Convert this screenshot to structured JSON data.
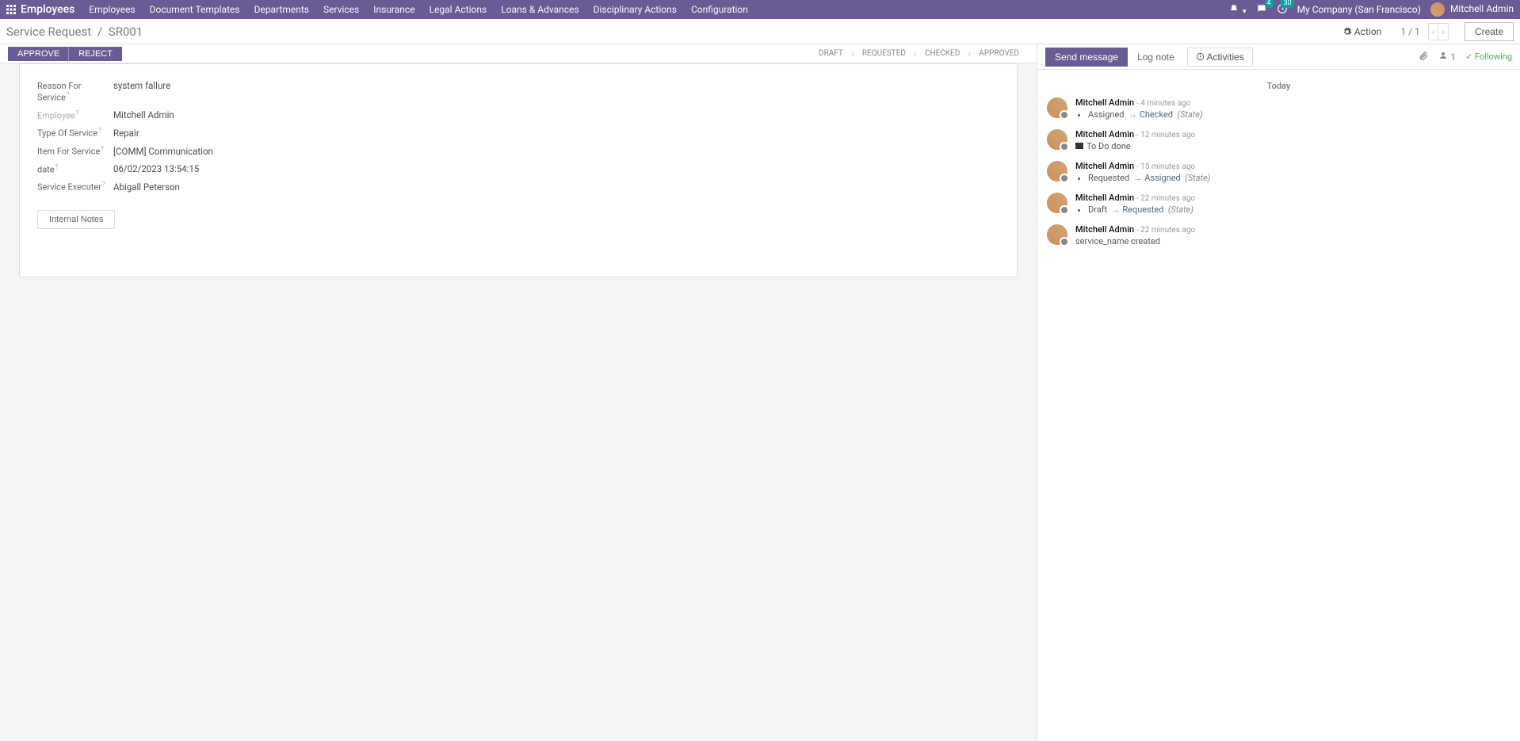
{
  "topnav": {
    "brand": "Employees",
    "menu": [
      "Employees",
      "Document Templates",
      "Departments",
      "Services",
      "Insurance",
      "Legal Actions",
      "Loans & Advances",
      "Disciplinary Actions",
      "Configuration"
    ],
    "msg_badge": "4",
    "clock_badge": "30",
    "company": "My Company (San Francisco)",
    "user": "Mitchell Admin"
  },
  "breadcrumb": {
    "a": "Service Request",
    "b": "SR001"
  },
  "action_label": "Action",
  "pager": "1 / 1",
  "create_label": "Create",
  "buttons": {
    "approve": "APPROVE",
    "reject": "REJECT"
  },
  "status_steps": [
    "DRAFT",
    "REQUESTED",
    "CHECKED",
    "APPROVED"
  ],
  "form": {
    "reason_label": "Reason For Service",
    "reason_val": "system fallure",
    "employee_label": "Employee",
    "employee_val": "Mitchell Admin",
    "type_label": "Type Of Service",
    "type_val": "Repair",
    "item_label": "Item For Service",
    "item_val": "[COMM] Communication",
    "date_label": "date",
    "date_val": "06/02/2023 13:54:15",
    "executer_label": "Service Executer",
    "executer_val": "Abigall Peterson",
    "tab_notes": "Internal Notes"
  },
  "chatter": {
    "send": "Send message",
    "log": "Log note",
    "activities": "Activities",
    "followers": "1",
    "following": "Following",
    "today": "Today",
    "messages": [
      {
        "author": "Mitchell Admin",
        "time": "- 4 minutes ago",
        "type": "bullet",
        "from": "Assigned",
        "to": "Checked",
        "suffix": "(State)"
      },
      {
        "author": "Mitchell Admin",
        "time": "- 12 minutes ago",
        "type": "done",
        "text": "To Do done"
      },
      {
        "author": "Mitchell Admin",
        "time": "- 15 minutes ago",
        "type": "bullet",
        "from": "Requested",
        "to": "Assigned",
        "suffix": "(State)"
      },
      {
        "author": "Mitchell Admin",
        "time": "- 22 minutes ago",
        "type": "bullet",
        "from": "Draft",
        "to": "Requested",
        "suffix": "(State)"
      },
      {
        "author": "Mitchell Admin",
        "time": "- 22 minutes ago",
        "type": "plain",
        "text": "service_name created"
      }
    ]
  }
}
